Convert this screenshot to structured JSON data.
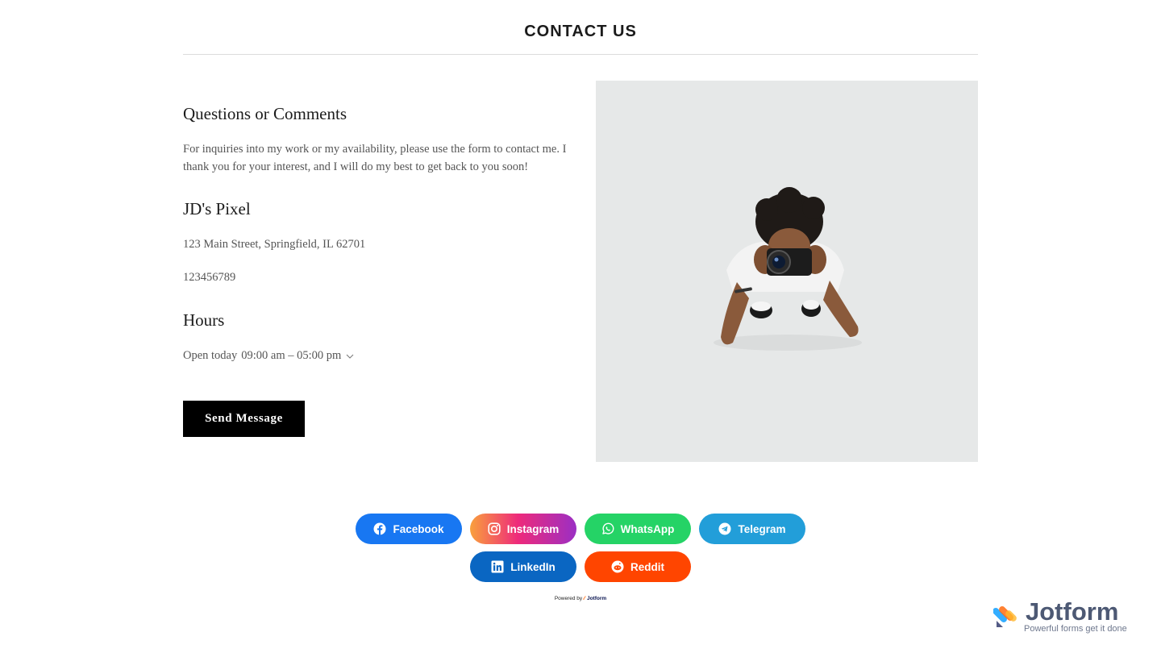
{
  "header": {
    "title": "CONTACT US"
  },
  "contact": {
    "questions_heading": "Questions or Comments",
    "questions_text": "For inquiries into my work or my availability, please use the form to contact me. I thank you for your interest, and I will do my best to get back to you soon!",
    "business_name": "JD's Pixel",
    "address": "123 Main Street, Springfield, IL 62701",
    "phone": "123456789",
    "hours_heading": "Hours",
    "hours_status": "Open today",
    "hours_range": "09:00 am – 05:00 pm",
    "send_button": "Send Message"
  },
  "photo": {
    "icon": "photographer-image"
  },
  "social": {
    "facebook": "Facebook",
    "instagram": "Instagram",
    "whatsapp": "WhatsApp",
    "telegram": "Telegram",
    "linkedin": "LinkedIn",
    "reddit": "Reddit"
  },
  "footer": {
    "powered_by": "Powered by",
    "powered_brand": "Jotform"
  },
  "badge": {
    "name": "Jotform",
    "tagline": "Powerful forms get it done"
  },
  "colors": {
    "facebook": "#1877f2",
    "whatsapp": "#25d366",
    "telegram": "#229ed9",
    "linkedin": "#0a66c2",
    "reddit": "#ff4500",
    "button": "#000000",
    "photo_bg": "#e6e8e8"
  }
}
